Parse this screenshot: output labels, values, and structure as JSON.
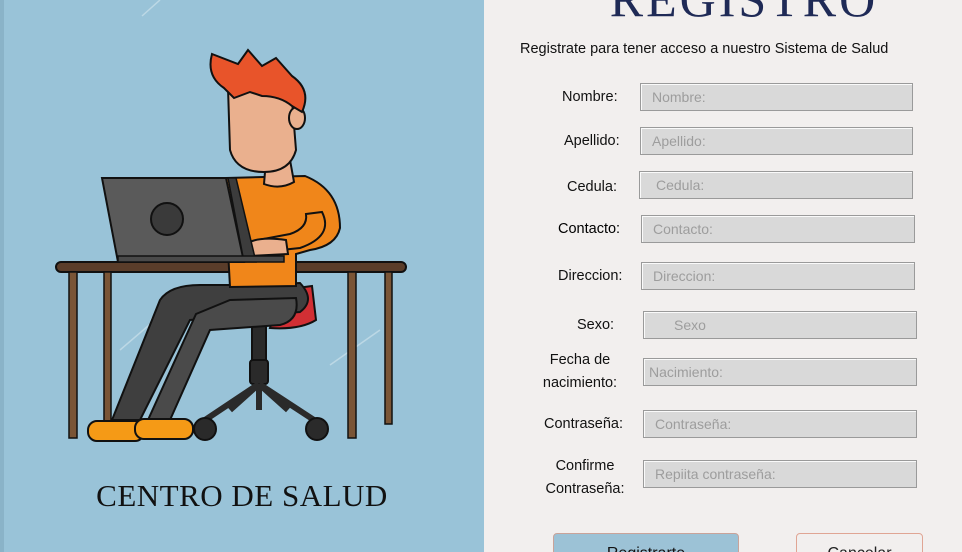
{
  "brand": {
    "name": "CENTRO DE SALUD"
  },
  "form": {
    "title": "REGISTRO",
    "subtitle": "Registrate para tener acceso a nuestro Sistema de Salud",
    "fields": [
      {
        "label": "Nombre:",
        "placeholder": "Nombre:"
      },
      {
        "label": "Apellido:",
        "placeholder": "Apellido:"
      },
      {
        "label": "Cedula:",
        "placeholder": "Cedula:"
      },
      {
        "label": "Contacto:",
        "placeholder": "Contacto:"
      },
      {
        "label": "Direccion:",
        "placeholder": "Direccion:"
      },
      {
        "label": "Sexo:",
        "placeholder": "Sexo"
      },
      {
        "label_line1": "Fecha de",
        "label_line2": "nacimiento:",
        "placeholder": "Nacimiento:"
      },
      {
        "label": "Contraseña:",
        "placeholder": "Contraseña:"
      },
      {
        "label_line1": "Confirme",
        "label_line2": "Contraseña:",
        "placeholder": "Repiita contraseña:"
      }
    ]
  },
  "buttons": {
    "register": "Registrarte",
    "cancel": "Cancelar"
  },
  "colors": {
    "left_panel": "#99c3d8",
    "title": "#1f2a56",
    "hair": "#e8542a",
    "shirt": "#f0861a",
    "chair": "#d12f34",
    "desk": "#7a5536",
    "laptop": "#5a5a5a"
  }
}
